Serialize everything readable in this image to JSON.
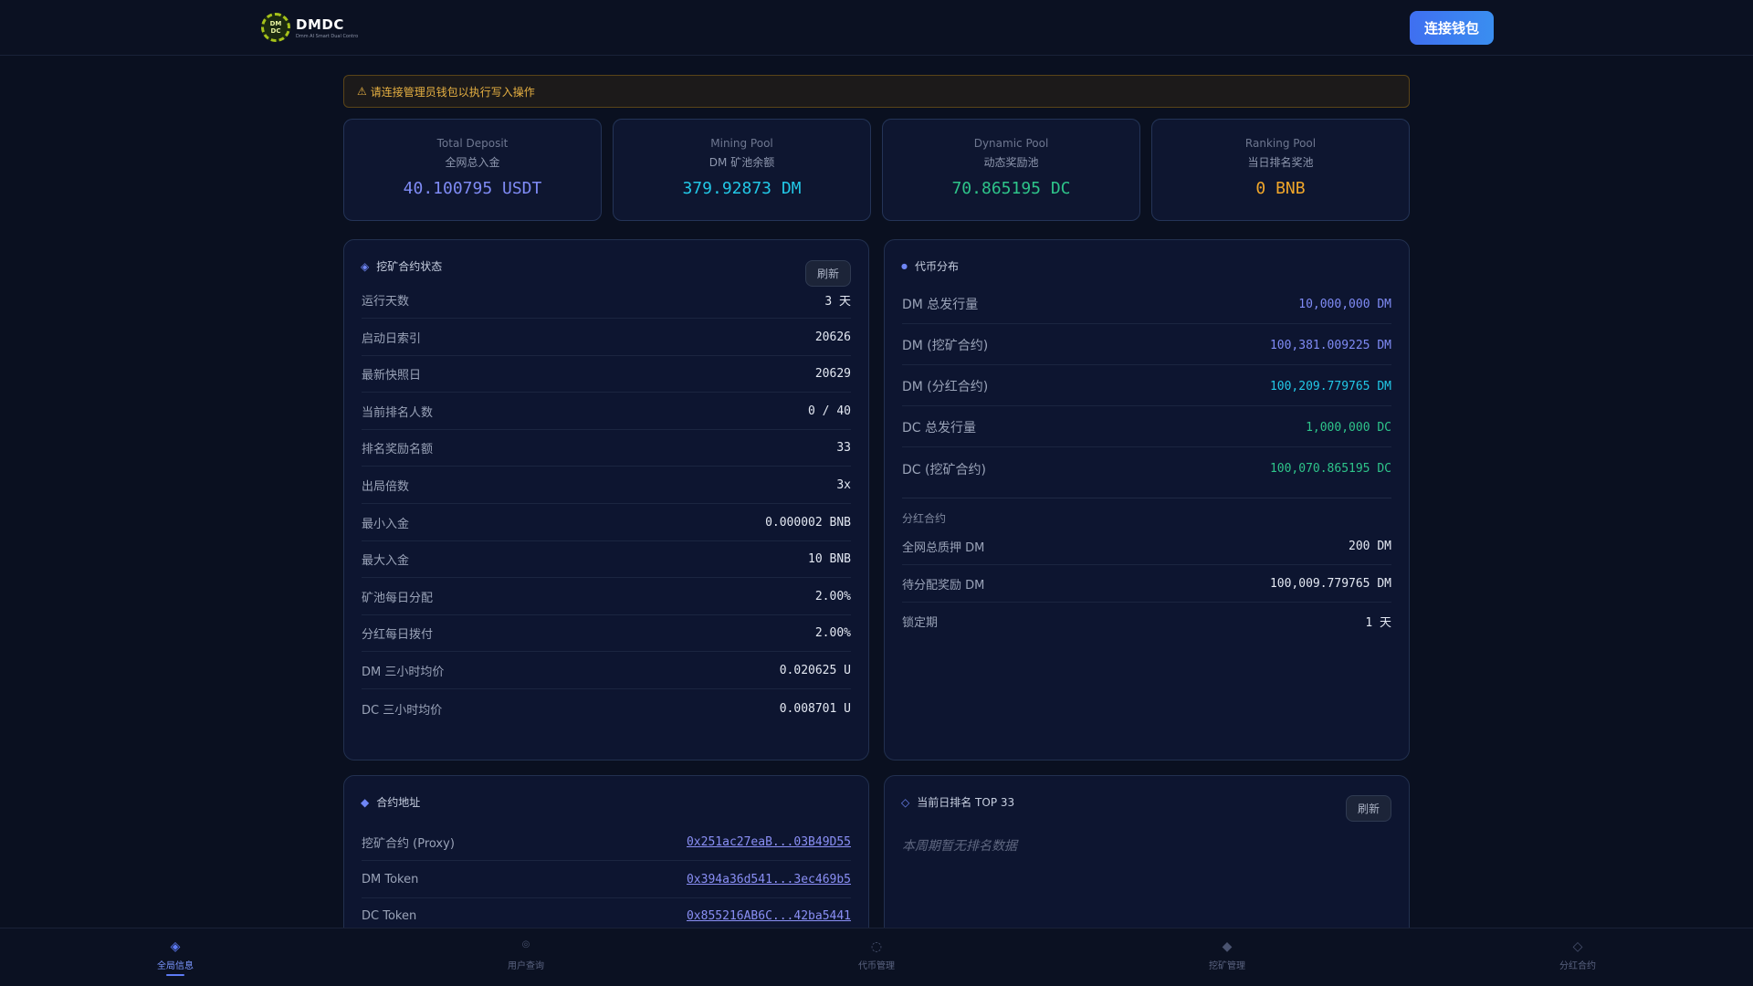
{
  "header": {
    "logo_badge_top": "DM",
    "logo_badge_bottom": "DC",
    "logo_title": "DMDC",
    "logo_sub": "Dmm AI Smart Dual Contro",
    "connect_label": "连接钱包"
  },
  "warning": {
    "icon": "warning-icon",
    "text": "请连接管理员钱包以执行写入操作"
  },
  "stats": [
    {
      "en": "Total Deposit",
      "cn": "全网总入金",
      "value": "40.100795 USDT",
      "color": "#7f8bf5"
    },
    {
      "en": "Mining Pool",
      "cn": "DM 矿池余额",
      "value": "379.92873 DM",
      "color": "#22c7e6"
    },
    {
      "en": "Dynamic Pool",
      "cn": "动态奖励池",
      "value": "70.865195 DC",
      "color": "#2ec48a"
    },
    {
      "en": "Ranking Pool",
      "cn": "当日排名奖池",
      "value": "0 BNB",
      "color": "#f0a62a"
    }
  ],
  "mining": {
    "title": "挖矿合约状态",
    "refresh": "刷新",
    "rows": [
      {
        "label": "运行天数",
        "value": "3 天"
      },
      {
        "label": "启动日索引",
        "value": "20626"
      },
      {
        "label": "最新快照日",
        "value": "20629"
      },
      {
        "label": "当前排名人数",
        "value": "0 / 40"
      },
      {
        "label": "排名奖励名额",
        "value": "33"
      },
      {
        "label": "出局倍数",
        "value": "3x"
      },
      {
        "label": "最小入金",
        "value": "0.000002 BNB"
      },
      {
        "label": "最大入金",
        "value": "10 BNB"
      },
      {
        "label": "矿池每日分配",
        "value": "2.00%"
      },
      {
        "label": "分红每日拨付",
        "value": "2.00%"
      },
      {
        "label": "DM 三小时均价",
        "value": "0.020625 U"
      },
      {
        "label": "DC 三小时均价",
        "value": "0.008701 U"
      }
    ]
  },
  "tokens": {
    "title": "代币分布",
    "rows": [
      {
        "label": "DM 总发行量",
        "value": "10,000,000 DM",
        "color": "#7f8bf5"
      },
      {
        "label": "DM (挖矿合约)",
        "value": "100,381.009225 DM",
        "color": "#7f8bf5"
      },
      {
        "label": "DM (分红合约)",
        "value": "100,209.779765 DM",
        "color": "#22c7e6"
      },
      {
        "label": "DC 总发行量",
        "value": "1,000,000 DC",
        "color": "#2ec48a"
      },
      {
        "label": "DC (挖矿合约)",
        "value": "100,070.865195 DC",
        "color": "#2ec48a"
      }
    ],
    "dividend_label": "分红合约",
    "dividend_rows": [
      {
        "label": "全网总质押 DM",
        "value": "200 DM"
      },
      {
        "label": "待分配奖励 DM",
        "value": "100,009.779765 DM"
      },
      {
        "label": "锁定期",
        "value": "1 天"
      }
    ]
  },
  "addresses": {
    "title": "合约地址",
    "rows": [
      {
        "label": "挖矿合约 (Proxy)",
        "value": "0x251ac27eaB...03B49D55"
      },
      {
        "label": "DM Token",
        "value": "0x394a36d541...3ec469b5"
      },
      {
        "label": "DC Token",
        "value": "0x855216AB6C...42ba5441"
      }
    ]
  },
  "ranking": {
    "title": "当前日排名 TOP 33",
    "refresh": "刷新",
    "empty": "本周期暂无排名数据"
  },
  "nav": [
    {
      "label": "全局信息",
      "icon": "diamond-icon",
      "active": true
    },
    {
      "label": "用户查询",
      "icon": "target-icon",
      "active": false
    },
    {
      "label": "代币管理",
      "icon": "coin-icon",
      "active": false
    },
    {
      "label": "挖矿管理",
      "icon": "pickaxe-diamond-icon",
      "active": false
    },
    {
      "label": "分红合约",
      "icon": "diamond-outline-icon",
      "active": false
    }
  ]
}
